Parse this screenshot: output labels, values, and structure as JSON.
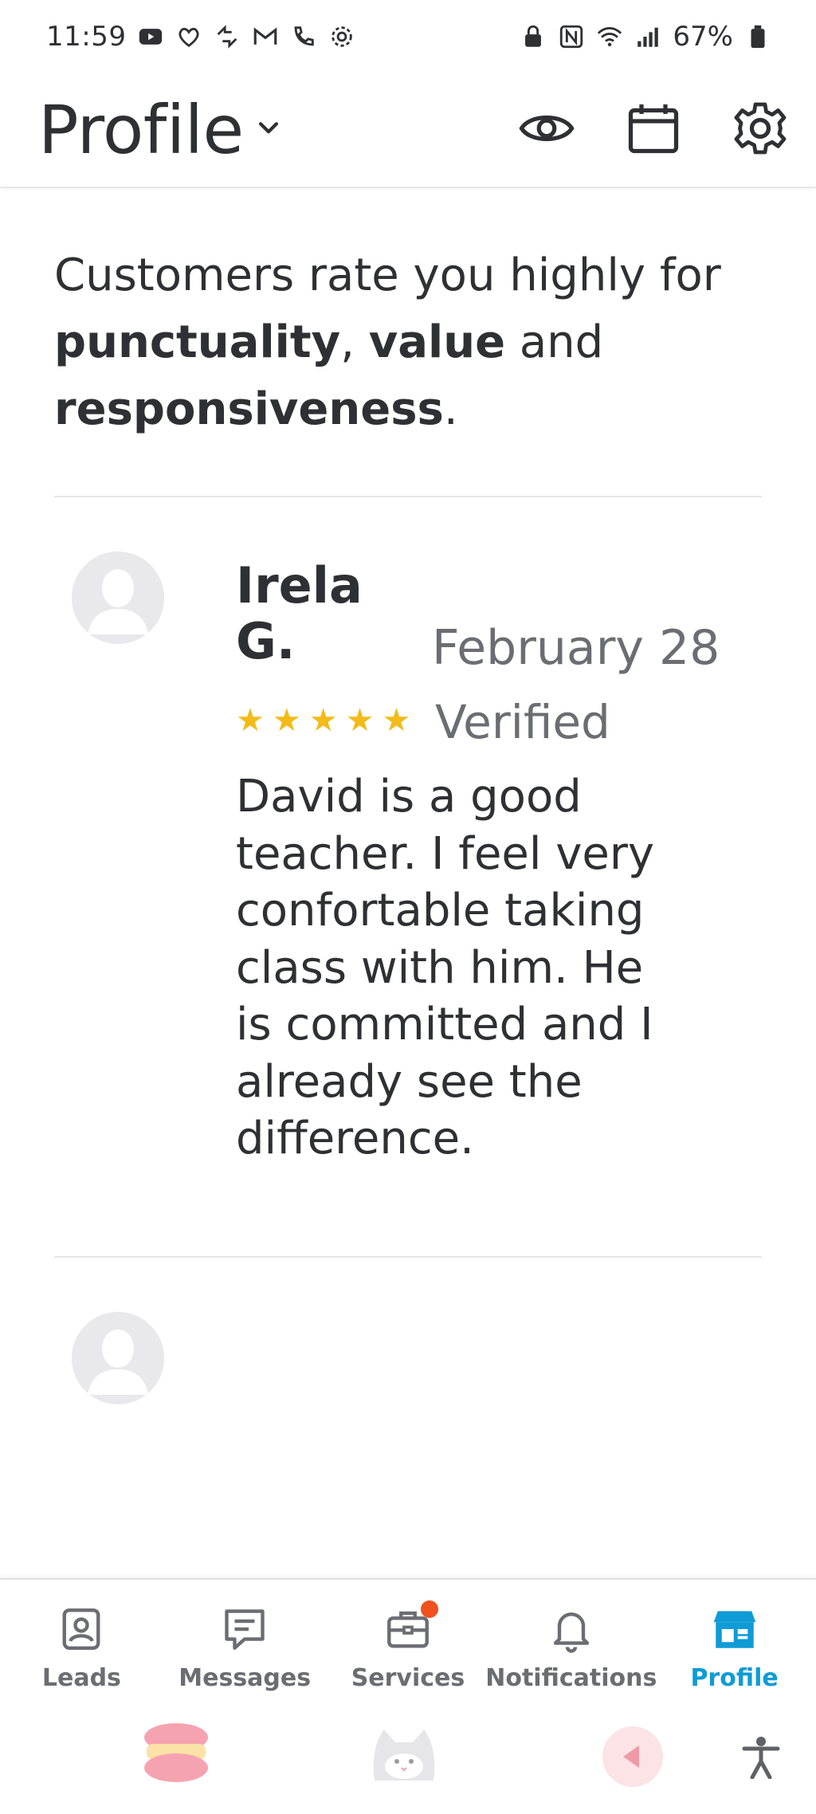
{
  "status_bar": {
    "time": "11:59",
    "battery": "67%"
  },
  "header": {
    "title": "Profile"
  },
  "summary": {
    "lead": "Customers rate you highly for ",
    "trait1": "punctuality",
    "sep1": ", ",
    "trait2": "value",
    "sep2": " and ",
    "trait3": "responsiveness",
    "end": "."
  },
  "review": {
    "name_line1": "Irela",
    "name_line2": "G.",
    "date": "February 28",
    "rating": 5,
    "star_glyph": "★",
    "verified": "Verified",
    "text": "David is a good teacher. I feel very confortable taking class with him. He is committed and I already see the difference."
  },
  "bottom_nav": {
    "items": [
      {
        "label": "Leads",
        "icon": "leads-icon"
      },
      {
        "label": "Messages",
        "icon": "messages-icon"
      },
      {
        "label": "Services",
        "icon": "services-icon"
      },
      {
        "label": "Notifications",
        "icon": "notifications-icon"
      },
      {
        "label": "Profile",
        "icon": "profile-icon"
      }
    ],
    "active": "Profile"
  },
  "colors": {
    "accent": "#0f9bd6",
    "star": "#f2bb1a",
    "badge": "#f0521f",
    "text": "#2f3033",
    "muted": "#6b6d72"
  }
}
